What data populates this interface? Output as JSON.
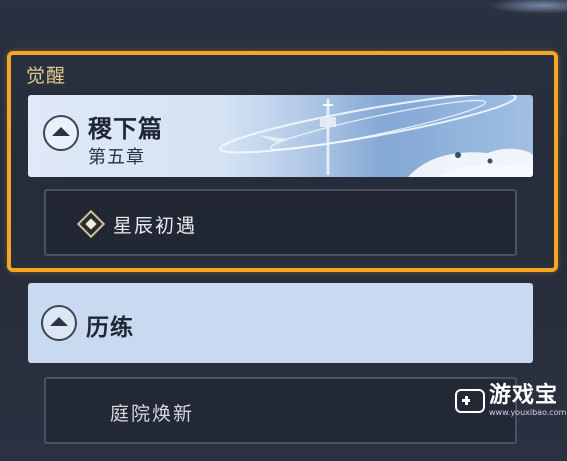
{
  "section": {
    "label": "觉醒"
  },
  "chapter": {
    "title": "稷下篇",
    "subtitle": "第五章",
    "expanded": true
  },
  "chapter_items": [
    {
      "label": "星辰初遇",
      "icon": "diamond-marker-icon"
    }
  ],
  "group": {
    "title": "历练",
    "expanded": true
  },
  "group_items": [
    {
      "label": "庭院焕新"
    }
  ],
  "watermark": {
    "name": "游戏宝",
    "url": "www.youxibao.com"
  },
  "colors": {
    "highlight": "#f5a623",
    "section_label": "#e3c98c",
    "card_light": "#c9d9ef",
    "background": "#262c39"
  }
}
